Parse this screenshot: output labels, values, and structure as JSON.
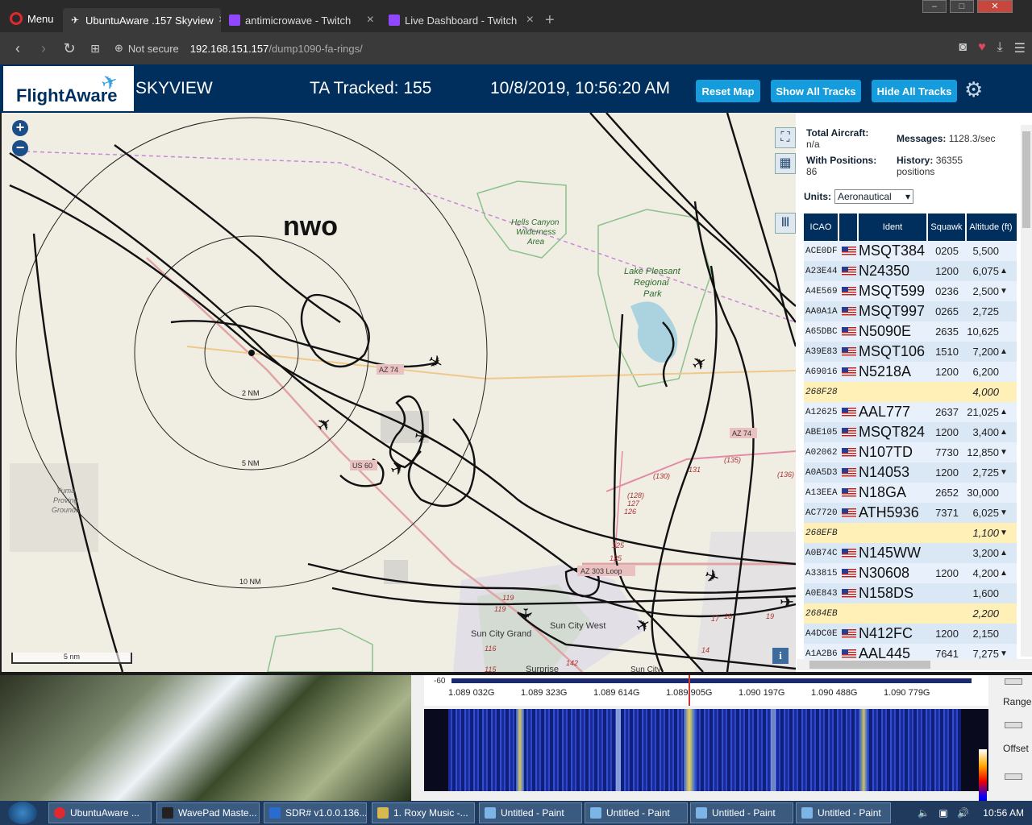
{
  "browser": {
    "menu_label": "Menu",
    "tabs": [
      {
        "label": "UbuntuAware .157 Skyview"
      },
      {
        "label": "antimicrowave - Twitch"
      },
      {
        "label": "Live Dashboard - Twitch"
      }
    ],
    "security": "Not secure",
    "url_host": "192.168.151.157",
    "url_path": "/dump1090-fa-rings/"
  },
  "header": {
    "logo": "FlightAware",
    "title": "SKYVIEW",
    "tracked": "TA Tracked: 155",
    "datetime": "10/8/2019, 10:56:20 AM",
    "buttons": {
      "reset": "Reset Map",
      "show": "Show All Tracks",
      "hide": "Hide All Tracks"
    }
  },
  "map": {
    "label": "nwo",
    "rings": [
      "2 NM",
      "5 NM",
      "10 NM"
    ],
    "scale": "5 nm",
    "places": [
      "Hells Canyon Wilderness Area",
      "Lake Pleasant Regional Park",
      "Yuma Proving Grounds",
      "Sun City West",
      "Sun City Grand",
      "Surprise",
      "Sun City"
    ],
    "roads": [
      "AZ 74",
      "US 60",
      "AZ 303 Loop",
      "131",
      "135",
      "130",
      "128",
      "127",
      "125",
      "119",
      "116",
      "115",
      "142",
      "136",
      "17",
      "16",
      "19",
      "14"
    ]
  },
  "stats": {
    "total_label": "Total Aircraft:",
    "total_value": "n/a",
    "messages_label": "Messages:",
    "messages_value": "1128.3/sec",
    "positions_label": "With Positions:",
    "positions_value": "86",
    "history_label": "History:",
    "history_value": "36355 positions",
    "units_label": "Units:",
    "units_value": "Aeronautical"
  },
  "table": {
    "headers": {
      "icao": "ICAO",
      "ident": "Ident",
      "squawk": "Squawk",
      "altitude": "Altitude (ft)"
    },
    "rows": [
      {
        "icao": "ACE0DF",
        "flag": true,
        "ident": "MSQT384",
        "squawk": "0205",
        "alt": "5,500",
        "arrow": ""
      },
      {
        "icao": "A23E44",
        "flag": true,
        "ident": "N24350",
        "squawk": "1200",
        "alt": "6,075",
        "arrow": "▲"
      },
      {
        "icao": "A4E569",
        "flag": true,
        "ident": "MSQT599",
        "squawk": "0236",
        "alt": "2,500",
        "arrow": "▼"
      },
      {
        "icao": "AA0A1A",
        "flag": true,
        "ident": "MSQT997",
        "squawk": "0265",
        "alt": "2,725",
        "arrow": ""
      },
      {
        "icao": "A65DBC",
        "flag": true,
        "ident": "N5090E",
        "squawk": "2635",
        "alt": "10,625",
        "arrow": ""
      },
      {
        "icao": "A39E83",
        "flag": true,
        "ident": "MSQT106",
        "squawk": "1510",
        "alt": "7,200",
        "arrow": "▲"
      },
      {
        "icao": "A69016",
        "flag": true,
        "ident": "N5218A",
        "squawk": "1200",
        "alt": "6,200",
        "arrow": ""
      },
      {
        "icao": "268F28",
        "flag": false,
        "ident": "",
        "squawk": "",
        "alt": "4,000",
        "arrow": "",
        "tisb": true
      },
      {
        "icao": "A12625",
        "flag": true,
        "ident": "AAL777",
        "squawk": "2637",
        "alt": "21,025",
        "arrow": "▲"
      },
      {
        "icao": "ABE105",
        "flag": true,
        "ident": "MSQT824",
        "squawk": "1200",
        "alt": "3,400",
        "arrow": "▲"
      },
      {
        "icao": "A02062",
        "flag": true,
        "ident": "N107TD",
        "squawk": "7730",
        "alt": "12,850",
        "arrow": "▼"
      },
      {
        "icao": "A0A5D3",
        "flag": true,
        "ident": "N14053",
        "squawk": "1200",
        "alt": "2,725",
        "arrow": "▼"
      },
      {
        "icao": "A13EEA",
        "flag": true,
        "ident": "N18GA",
        "squawk": "2652",
        "alt": "30,000",
        "arrow": ""
      },
      {
        "icao": "AC7720",
        "flag": true,
        "ident": "ATH5936",
        "squawk": "7371",
        "alt": "6,025",
        "arrow": "▼"
      },
      {
        "icao": "268EFB",
        "flag": false,
        "ident": "",
        "squawk": "",
        "alt": "1,100",
        "arrow": "▼",
        "tisb": true
      },
      {
        "icao": "A0B74C",
        "flag": true,
        "ident": "N145WW",
        "squawk": "",
        "alt": "3,200",
        "arrow": "▲"
      },
      {
        "icao": "A33815",
        "flag": true,
        "ident": "N30608",
        "squawk": "1200",
        "alt": "4,200",
        "arrow": "▲"
      },
      {
        "icao": "A0E843",
        "flag": true,
        "ident": "N158DS",
        "squawk": "",
        "alt": "1,600",
        "arrow": ""
      },
      {
        "icao": "2684EB",
        "flag": false,
        "ident": "",
        "squawk": "",
        "alt": "2,200",
        "arrow": "",
        "tisb": true
      },
      {
        "icao": "A4DC0E",
        "flag": true,
        "ident": "N412FC",
        "squawk": "1200",
        "alt": "2,150",
        "arrow": ""
      },
      {
        "icao": "A1A2B6",
        "flag": true,
        "ident": "AAL445",
        "squawk": "7641",
        "alt": "7,275",
        "arrow": "▼"
      }
    ]
  },
  "sdr": {
    "db_label": "-60",
    "freqs": [
      "1.089 032G",
      "1.089 323G",
      "1.089 614G",
      "1.089 905G",
      "1.090 197G",
      "1.090 488G",
      "1.090 779G"
    ],
    "range_label": "Range",
    "offset_label": "Offset"
  },
  "taskbar": {
    "items": [
      "UbuntuAware ...",
      "WavePad Maste...",
      "SDR# v1.0.0.136...",
      "1. Roxy Music -...",
      "Untitled - Paint",
      "Untitled - Paint",
      "Untitled - Paint",
      "Untitled - Paint"
    ],
    "time": "10:56 AM"
  }
}
